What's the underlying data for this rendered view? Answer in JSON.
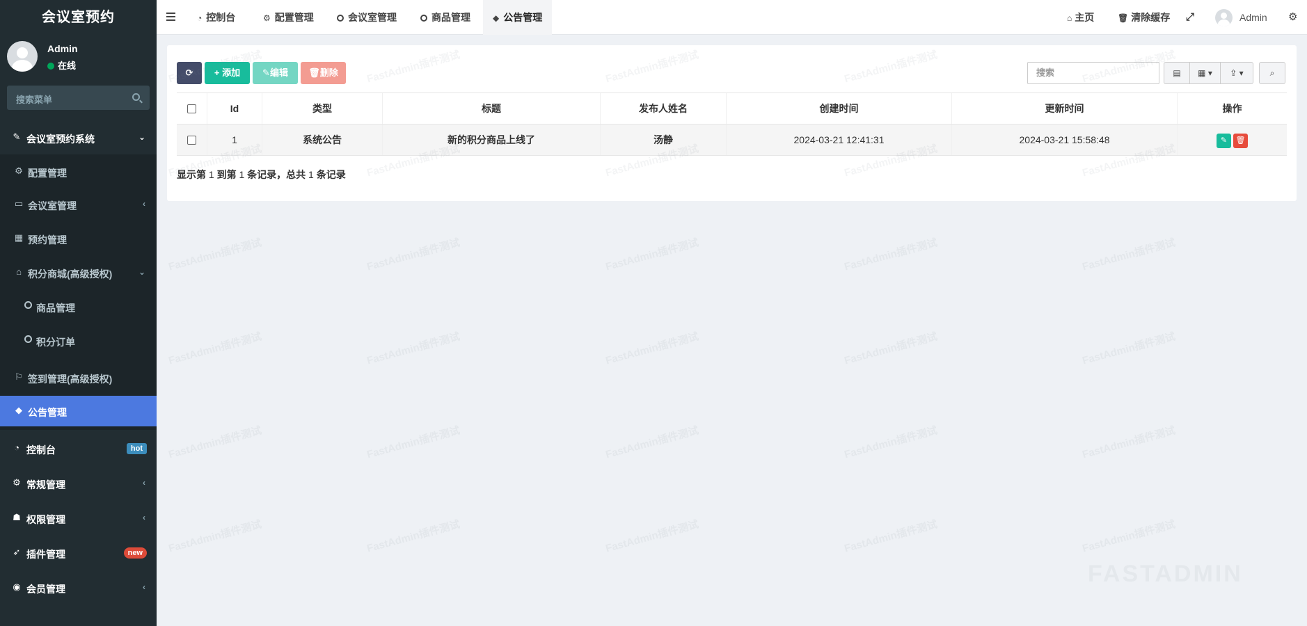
{
  "sidebar": {
    "brand": "会议室预约",
    "user": {
      "name": "Admin",
      "status": "在线"
    },
    "search_placeholder": "搜索菜单",
    "items": [
      {
        "label": "会议室预约系统",
        "icon": "magic-wand-icon"
      },
      {
        "label": "配置管理",
        "icon": "gear-icon"
      },
      {
        "label": "会议室管理",
        "icon": "monitor-icon"
      },
      {
        "label": "预约管理",
        "icon": "table-icon"
      },
      {
        "label": "积分商城(高级授权)",
        "icon": "basket-icon"
      },
      {
        "label": "商品管理",
        "icon": "circle-icon"
      },
      {
        "label": "积分订单",
        "icon": "circle-icon"
      },
      {
        "label": "签到管理(高级授权)",
        "icon": "bookmark-icon"
      },
      {
        "label": "公告管理",
        "icon": "tag-icon"
      },
      {
        "label": "控制台",
        "icon": "dashboard-icon",
        "badge": "hot"
      },
      {
        "label": "常规管理",
        "icon": "cogs-icon"
      },
      {
        "label": "权限管理",
        "icon": "group-icon"
      },
      {
        "label": "插件管理",
        "icon": "rocket-icon",
        "badge": "new"
      },
      {
        "label": "会员管理",
        "icon": "user-circle-icon"
      }
    ]
  },
  "topbar": {
    "tabs": [
      {
        "label": "控制台",
        "icon": "dashboard-icon"
      },
      {
        "label": "配置管理",
        "icon": "gear-icon"
      },
      {
        "label": "会议室管理",
        "icon": "circle-icon"
      },
      {
        "label": "商品管理",
        "icon": "circle-icon"
      },
      {
        "label": "公告管理",
        "icon": "tag-icon"
      }
    ],
    "home": "主页",
    "clear_cache": "清除缓存",
    "user": "Admin"
  },
  "toolbar": {
    "add": "添加",
    "edit": "编辑",
    "delete": "删除",
    "search_placeholder": "搜索"
  },
  "table": {
    "columns": [
      "Id",
      "类型",
      "标题",
      "发布人姓名",
      "创建时间",
      "更新时间",
      "操作"
    ],
    "rows": [
      {
        "id": "1",
        "type": "系统公告",
        "title": "新的积分商品上线了",
        "publisher": "汤静",
        "created": "2024-03-21 12:41:31",
        "updated": "2024-03-21 15:58:48"
      }
    ]
  },
  "pagination": {
    "p1": "显示第",
    "from": "1",
    "p2": "到第",
    "to": "1",
    "p3": "条记录，总共",
    "total": "1",
    "p4": "条记录"
  },
  "watermark": "FastAdmin插件测试",
  "footer_logo": "FASTADMIN",
  "colors": {
    "sidebar_bg": "#222d32",
    "active_menu": "#4c79e0",
    "primary": "#18bc9c",
    "danger": "#e74c3c",
    "dark_button": "#444c69"
  }
}
